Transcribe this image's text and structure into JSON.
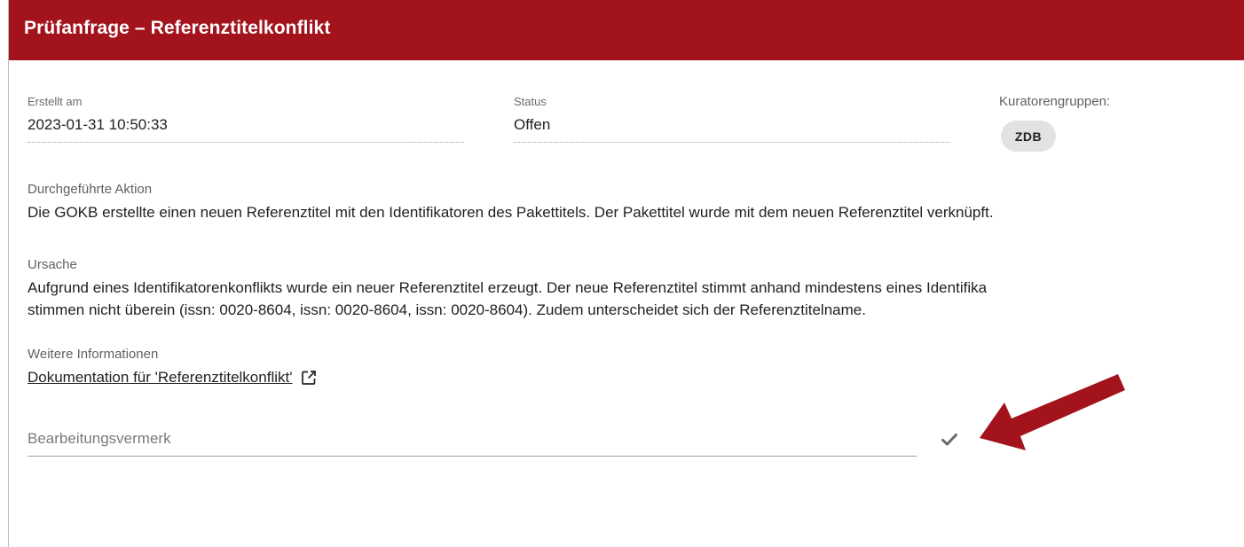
{
  "dialog": {
    "title": "Prüfanfrage – Referenztitelkonflikt"
  },
  "meta": {
    "created_label": "Erstellt am",
    "created_value": "2023-01-31 10:50:33",
    "status_label": "Status",
    "status_value": "Offen",
    "groups_label": "Kuratorengruppen:",
    "groups": [
      "ZDB"
    ]
  },
  "action": {
    "label": "Durchgeführte Aktion",
    "text": "Die GOKB erstellte einen neuen Referenztitel mit den Identifikatoren des Pakettitels. Der Pakettitel wurde mit dem neuen Referenztitel verknüpft."
  },
  "cause": {
    "label": "Ursache",
    "line1": "Aufgrund eines Identifikatorenkonflikts wurde ein neuer Referenztitel erzeugt. Der neue Referenztitel stimmt anhand mindestens eines Identifika",
    "line2": "stimmen nicht überein (issn: 0020-8604, issn: 0020-8604, issn: 0020-8604). Zudem unterscheidet sich der Referenztitelname."
  },
  "more_info": {
    "label": "Weitere Informationen",
    "link_text": "Dokumentation für 'Referenztitelkonflikt'"
  },
  "note": {
    "placeholder": "Bearbeitungsvermerk",
    "value": ""
  },
  "icons": {
    "external_link": "external-link-icon",
    "confirm": "check-icon",
    "annotation": "red-arrow-annotation"
  },
  "colors": {
    "header_bg": "#a3131c",
    "header_text": "#ffffff",
    "chip_bg": "#e2e2e2",
    "arrow": "#a3131c",
    "check": "#6b6b6b"
  }
}
